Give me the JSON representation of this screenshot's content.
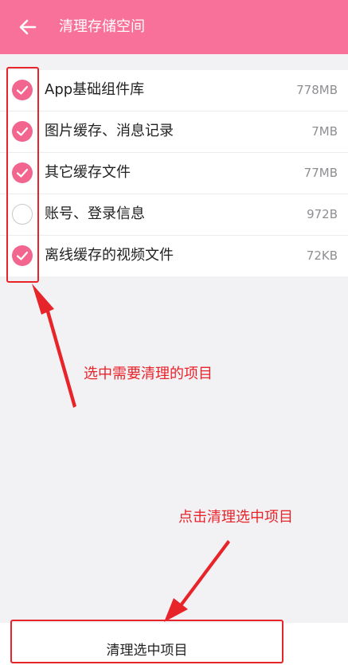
{
  "header": {
    "title": "清理存储空间"
  },
  "items": [
    {
      "label": "App基础组件库",
      "size": "778MB",
      "checked": true
    },
    {
      "label": "图片缓存、消息记录",
      "size": "7MB",
      "checked": true
    },
    {
      "label": "其它缓存文件",
      "size": "77MB",
      "checked": true
    },
    {
      "label": "账号、登录信息",
      "size": "972B",
      "checked": false
    },
    {
      "label": "离线缓存的视频文件",
      "size": "72KB",
      "checked": true
    }
  ],
  "annotations": {
    "select_hint": "选中需要清理的项目",
    "button_hint": "点击清理选中项目"
  },
  "footer": {
    "clean_button_label": "清理选中项目"
  },
  "colors": {
    "accent": "#f7719a",
    "check": "#f2658f",
    "annotation": "#e8242b"
  }
}
